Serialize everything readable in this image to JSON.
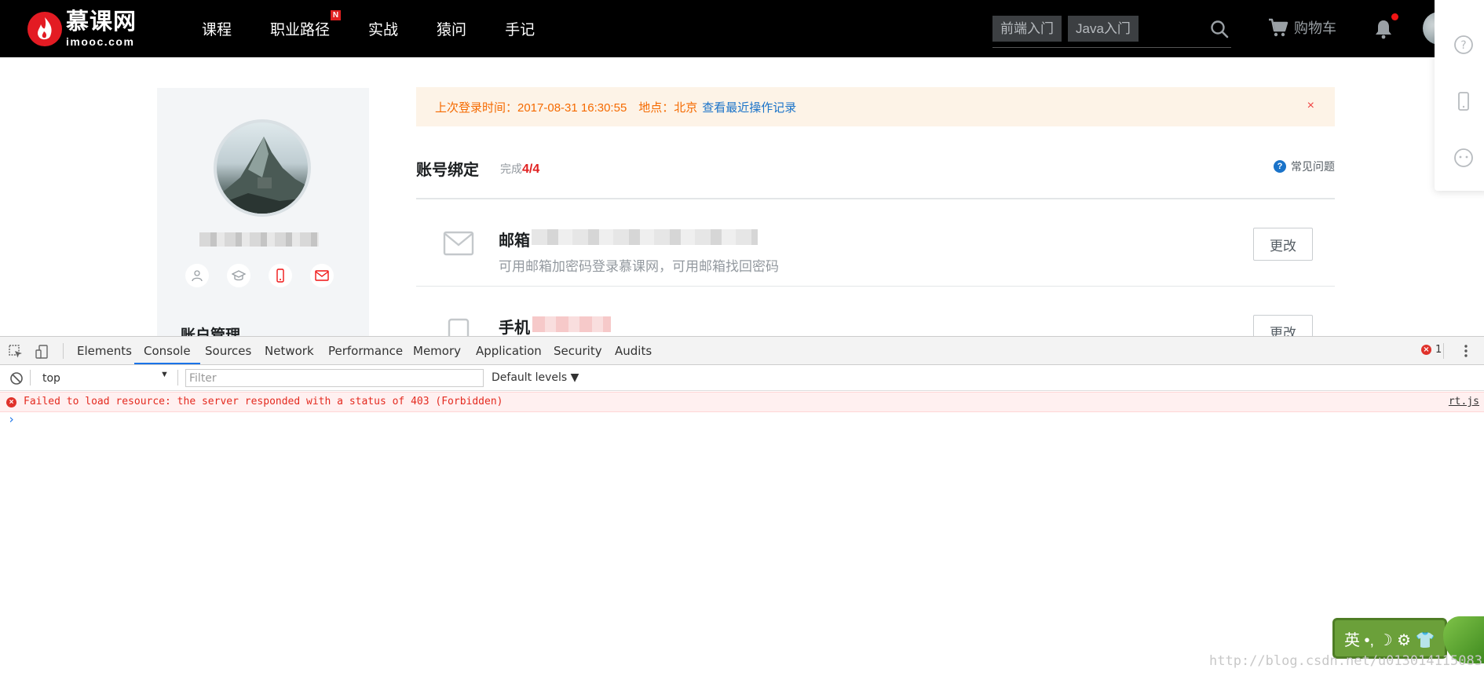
{
  "header": {
    "logo_cn": "慕课网",
    "logo_en": "imooc.com",
    "nav": [
      {
        "label": "课程",
        "badge": ""
      },
      {
        "label": "职业路径",
        "badge": "N"
      },
      {
        "label": "实战",
        "badge": ""
      },
      {
        "label": "猿问",
        "badge": ""
      },
      {
        "label": "手记",
        "badge": ""
      }
    ],
    "search_tags": [
      "前端入门",
      "Java入门"
    ],
    "cart_label": "购物车"
  },
  "profile": {
    "name": " ",
    "section_title": "账户管理"
  },
  "notice": {
    "text": "上次登录时间：2017-08-31 16:30:55　地点：北京",
    "link": "查看最近操作记录",
    "close": "×"
  },
  "binding": {
    "title": "账号绑定",
    "progress_prefix": "完成",
    "progress_value": "4/4",
    "faq": "常见问题",
    "rows": [
      {
        "label": "邮箱",
        "desc": "可用邮箱加密码登录慕课网，可用邮箱找回密码",
        "button": "更改"
      },
      {
        "label": "手机",
        "desc": "",
        "button": "更改"
      }
    ]
  },
  "devtools": {
    "tabs": [
      "Elements",
      "Console",
      "Sources",
      "Network",
      "Performance",
      "Memory",
      "Application",
      "Security",
      "Audits"
    ],
    "active_tab": "Console",
    "error_count": "1",
    "context": "top",
    "filter_placeholder": "Filter",
    "levels": "Default levels ▼",
    "messages": [
      {
        "level": "error",
        "text": "Failed to load resource: the server responded with a status of 403 (Forbidden)",
        "source": "rt.js"
      }
    ],
    "prompt": "›"
  },
  "ime": {
    "label": "英 •, ☽ ⚙ 👕"
  },
  "watermark": "http://blog.csdn.net/u013014115083"
}
